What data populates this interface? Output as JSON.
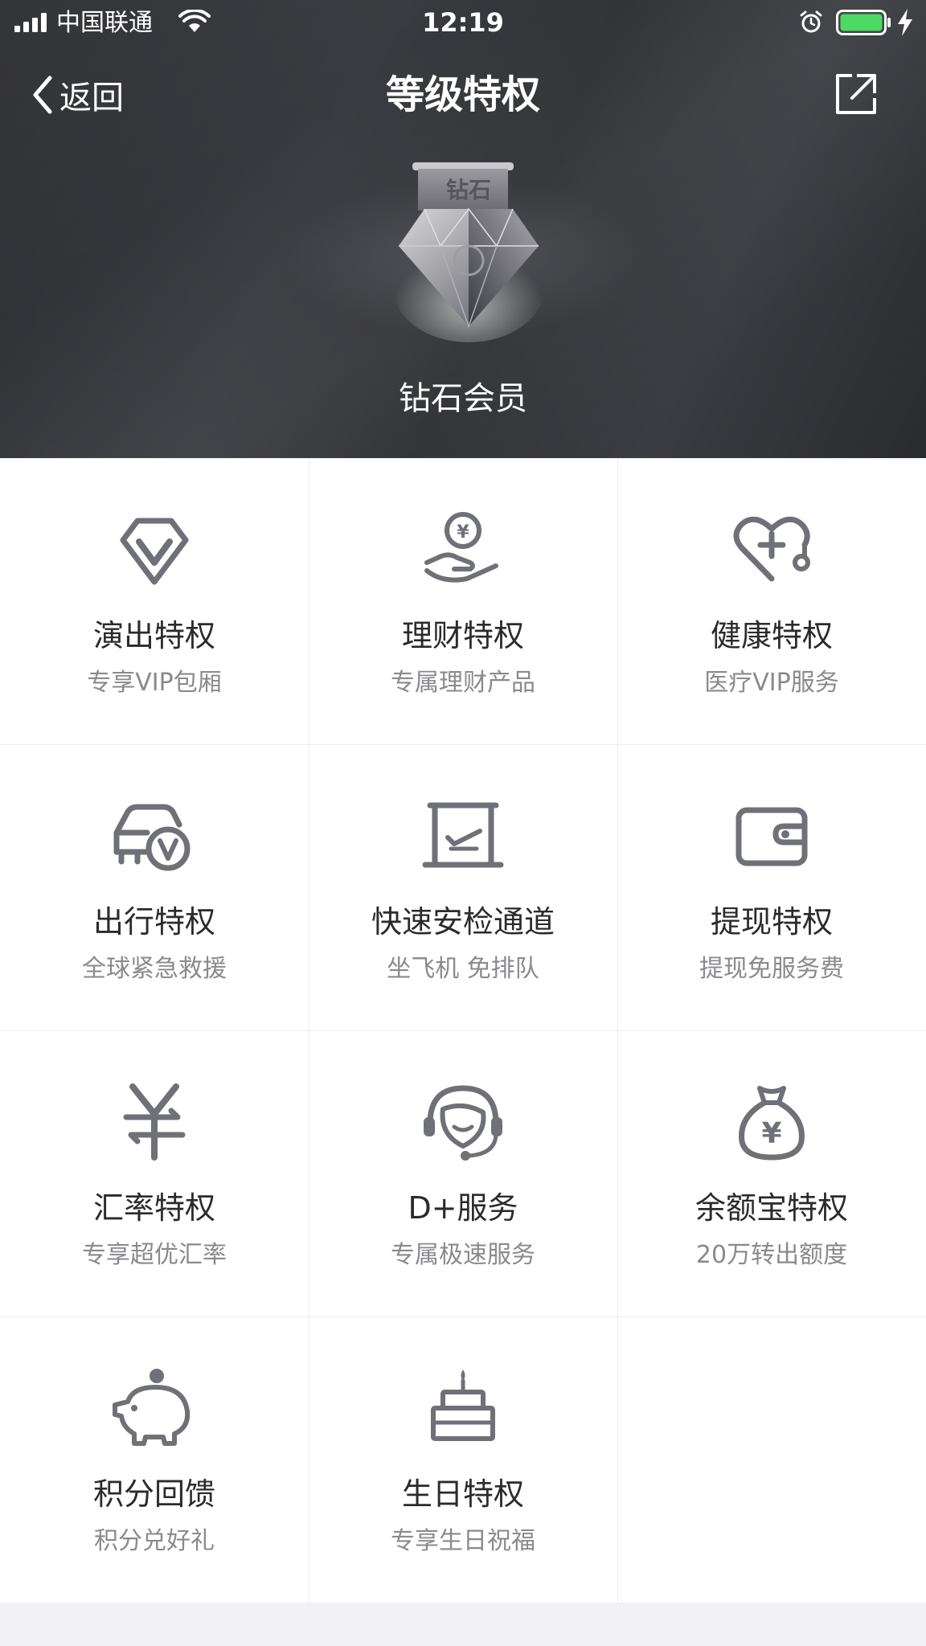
{
  "status_bar": {
    "carrier": "中国联通",
    "time": "12:19"
  },
  "nav": {
    "back_label": "返回",
    "title": "等级特权"
  },
  "hero": {
    "badge_text": "钻石",
    "member_level": "钻石会员"
  },
  "colors": {
    "icon_gray": "#6f7078",
    "battery_green": "#4cd964",
    "divider": "#ececee"
  },
  "privileges": [
    {
      "title": "演出特权",
      "subtitle": "专享VIP包厢",
      "icon": "diamond-v-icon"
    },
    {
      "title": "理财特权",
      "subtitle": "专属理财产品",
      "icon": "hand-coin-icon"
    },
    {
      "title": "健康特权",
      "subtitle": "医疗VIP服务",
      "icon": "stethoscope-icon"
    },
    {
      "title": "出行特权",
      "subtitle": "全球紧急救援",
      "icon": "car-v-icon"
    },
    {
      "title": "快速安检通道",
      "subtitle": "坐飞机 免排队",
      "icon": "airport-gate-icon"
    },
    {
      "title": "提现特权",
      "subtitle": "提现免服务费",
      "icon": "wallet-icon"
    },
    {
      "title": "汇率特权",
      "subtitle": "专享超优汇率",
      "icon": "yuan-exchange-icon"
    },
    {
      "title": "D+服务",
      "subtitle": "专属极速服务",
      "icon": "headset-agent-icon"
    },
    {
      "title": "余额宝特权",
      "subtitle": "20万转出额度",
      "icon": "money-bag-icon"
    },
    {
      "title": "积分回馈",
      "subtitle": "积分兑好礼",
      "icon": "piggy-bank-icon"
    },
    {
      "title": "生日特权",
      "subtitle": "专享生日祝福",
      "icon": "birthday-cake-icon"
    }
  ]
}
